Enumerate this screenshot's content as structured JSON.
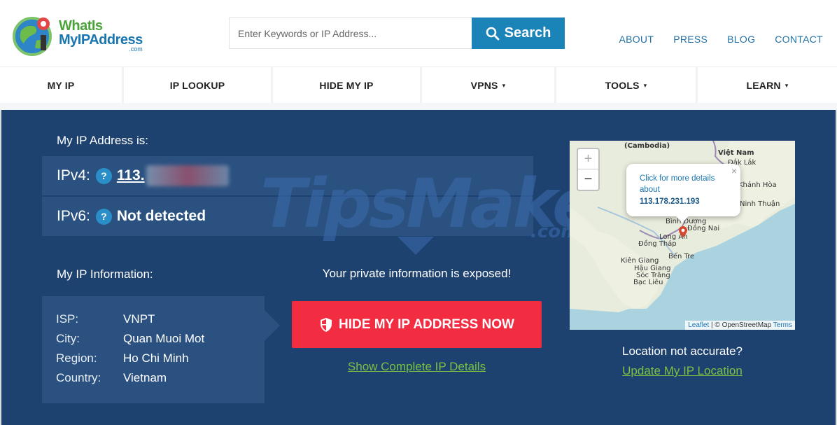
{
  "header": {
    "logo": {
      "line1": "WhatIs",
      "line2": "MyIPAddress",
      "line3": ".com"
    },
    "search": {
      "placeholder": "Enter Keywords or IP Address...",
      "button_label": "Search"
    },
    "top_links": [
      "ABOUT",
      "PRESS",
      "BLOG",
      "CONTACT"
    ]
  },
  "nav": {
    "items": [
      {
        "label": "MY IP",
        "dropdown": false
      },
      {
        "label": "IP LOOKUP",
        "dropdown": false
      },
      {
        "label": "HIDE MY IP",
        "dropdown": false
      },
      {
        "label": "VPNS",
        "dropdown": true
      },
      {
        "label": "TOOLS",
        "dropdown": true
      },
      {
        "label": "LEARN",
        "dropdown": true
      }
    ],
    "caret": "▾"
  },
  "main": {
    "ip_heading": "My IP Address is:",
    "ipv4": {
      "label": "IPv4:",
      "value": "113."
    },
    "ipv6": {
      "label": "IPv6:",
      "value": "Not detected"
    },
    "help_mark": "?",
    "info_heading": "My IP Information:",
    "info": [
      {
        "key": "ISP:",
        "value": "VNPT"
      },
      {
        "key": "City:",
        "value": "Quan Muoi Mot"
      },
      {
        "key": "Region:",
        "value": "Ho Chi Minh"
      },
      {
        "key": "Country:",
        "value": "Vietnam"
      }
    ],
    "exposed_text": "Your private information is exposed!",
    "hide_button_label": "HIDE MY IP ADDRESS NOW",
    "details_link": "Show Complete IP Details",
    "location_question": "Location not accurate?",
    "update_location_link": "Update My IP Location"
  },
  "map": {
    "zoom_in": "+",
    "zoom_out": "−",
    "popup": {
      "text": "Click for more details about",
      "ip": "113.178.231.193",
      "close": "×"
    },
    "labels": {
      "cambodia": "(Cambodia)",
      "viet_nam": "Việt Nam",
      "dak_lak": "Đắk Lắk",
      "khanh_hoa": "Khánh Hòa",
      "ninh_thuan": "Ninh Thuận",
      "binh_duong": "Bình Dương",
      "dong_nai": "Đồng Nai",
      "long_an": "Long An",
      "dong_thap": "Đồng Tháp",
      "kien_giang": "Kiên Giang",
      "ben_tre": "Bến Tre",
      "hau_giang": "Hậu Giang",
      "soc_trang": "Sóc Trăng",
      "bac_lieu": "Bạc Liêu"
    },
    "attribution": {
      "leaflet": "Leaflet",
      "sep": " | © OpenStreetMap ",
      "terms": "Terms"
    }
  },
  "watermark": {
    "text": "TipsMake",
    "suffix": ".com"
  },
  "colors": {
    "brand_blue": "#1a84b8",
    "main_bg": "#1e4270",
    "panel_bg": "#2b5180",
    "cta_red": "#f22d42",
    "link_green": "#7ac143"
  }
}
